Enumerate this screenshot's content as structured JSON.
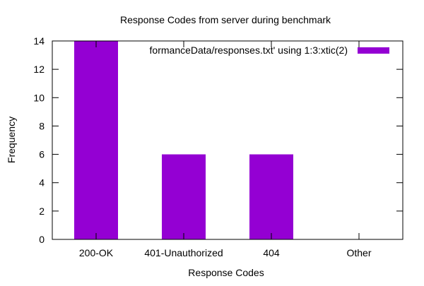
{
  "chart_data": {
    "type": "bar",
    "title": "Response Codes from server during benchmark",
    "xlabel": "Response Codes",
    "ylabel": "Frequency",
    "categories": [
      "200-OK",
      "401-Unauthorized",
      "404",
      "Other"
    ],
    "series": [
      {
        "name": "formanceData/responses.txt' using 1:3:xtic(2)",
        "values": [
          14,
          6,
          6,
          0
        ],
        "color": "#9400d3"
      }
    ],
    "ylim": [
      0,
      14
    ],
    "yticks": [
      0,
      2,
      4,
      6,
      8,
      10,
      12,
      14
    ],
    "grid": false,
    "legend_position": "top-right"
  }
}
